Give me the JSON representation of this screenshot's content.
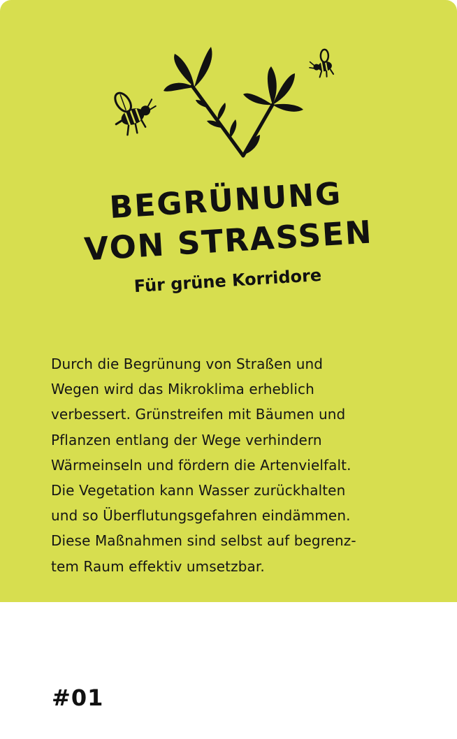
{
  "card": {
    "background_color": "#d7de4f",
    "title_line_1": "BEGRÜNUNG",
    "title_line_2": "VON STRASSEN",
    "subtitle": "Für grüne Korridore",
    "body_lines": [
      "Durch die Begrünung von Straßen und",
      "Wegen wird das Mikroklima erheblich",
      "verbessert. Grünstreifen mit Bäumen und",
      "Pflanzen entlang der Wege verhindern",
      "Wärmeinseln und fördern die Artenvielfalt.",
      "Die Vegetation kann Wasser zurückhalten",
      "und so Überflutungsgefahren eindämmen.",
      "Diese Maßnahmen sind selbst auf begrenz-",
      "tem Raum effektiv umsetzbar."
    ],
    "icons": [
      "bee-icon",
      "plant-icon",
      "bee-icon"
    ]
  },
  "footer": {
    "number": "#01"
  }
}
